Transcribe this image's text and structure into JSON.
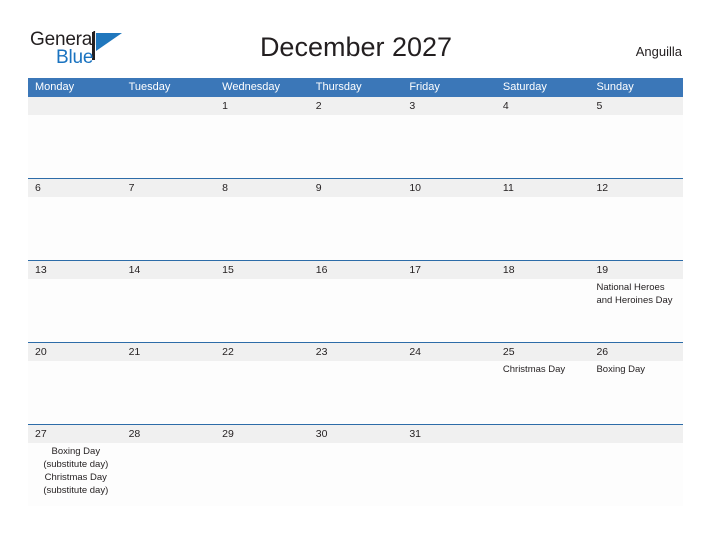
{
  "brand": {
    "word_one": "General",
    "word_two": "Blue",
    "logo_accent_color": "#2077bd"
  },
  "header": {
    "title": "December 2027",
    "region": "Anguilla",
    "header_bg_color": "#3b77b8"
  },
  "calendar": {
    "weekday_headers": [
      "Monday",
      "Tuesday",
      "Wednesday",
      "Thursday",
      "Friday",
      "Saturday",
      "Sunday"
    ],
    "weeks": [
      {
        "days": [
          {
            "num": "",
            "events": []
          },
          {
            "num": "",
            "events": []
          },
          {
            "num": "1",
            "events": []
          },
          {
            "num": "2",
            "events": []
          },
          {
            "num": "3",
            "events": []
          },
          {
            "num": "4",
            "events": []
          },
          {
            "num": "5",
            "events": []
          }
        ]
      },
      {
        "days": [
          {
            "num": "6",
            "events": []
          },
          {
            "num": "7",
            "events": []
          },
          {
            "num": "8",
            "events": []
          },
          {
            "num": "9",
            "events": []
          },
          {
            "num": "10",
            "events": []
          },
          {
            "num": "11",
            "events": []
          },
          {
            "num": "12",
            "events": []
          }
        ]
      },
      {
        "days": [
          {
            "num": "13",
            "events": []
          },
          {
            "num": "14",
            "events": []
          },
          {
            "num": "15",
            "events": []
          },
          {
            "num": "16",
            "events": []
          },
          {
            "num": "17",
            "events": []
          },
          {
            "num": "18",
            "events": []
          },
          {
            "num": "19",
            "events": [
              "National Heroes",
              "and Heroines Day"
            ]
          }
        ]
      },
      {
        "days": [
          {
            "num": "20",
            "events": []
          },
          {
            "num": "21",
            "events": []
          },
          {
            "num": "22",
            "events": []
          },
          {
            "num": "23",
            "events": []
          },
          {
            "num": "24",
            "events": []
          },
          {
            "num": "25",
            "events": [
              "Christmas Day"
            ]
          },
          {
            "num": "26",
            "events": [
              "Boxing Day"
            ]
          }
        ]
      },
      {
        "days": [
          {
            "num": "27",
            "events": [
              "Boxing Day",
              "(substitute day)",
              "Christmas Day",
              "(substitute day)"
            ],
            "centered": true
          },
          {
            "num": "28",
            "events": []
          },
          {
            "num": "29",
            "events": []
          },
          {
            "num": "30",
            "events": []
          },
          {
            "num": "31",
            "events": []
          },
          {
            "num": "",
            "events": []
          },
          {
            "num": "",
            "events": []
          }
        ]
      }
    ]
  }
}
